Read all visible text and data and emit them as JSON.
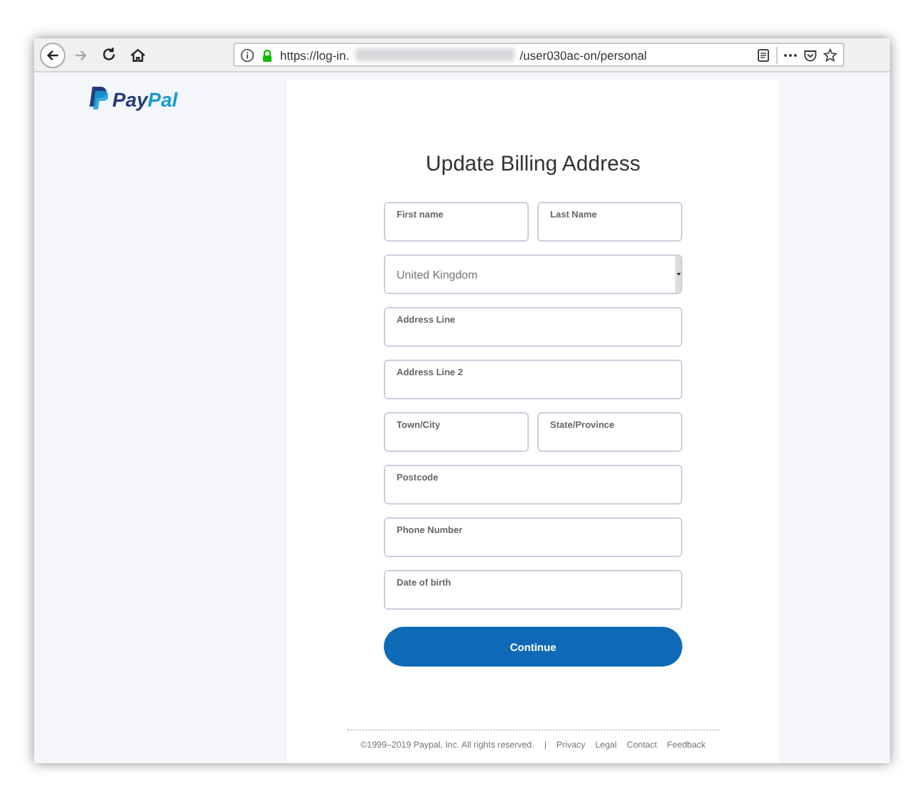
{
  "browser": {
    "nav": [
      {
        "kind": "back",
        "disabled": false
      },
      {
        "kind": "forward",
        "disabled": true
      },
      {
        "kind": "reload",
        "disabled": false
      },
      {
        "kind": "home",
        "disabled": false
      }
    ],
    "url_prefix": "https://log-in.",
    "url_suffix": "/user030ac-on/personal"
  },
  "logo": [
    "Pay",
    "Pal"
  ],
  "title": "Update Billing Address",
  "form_rows": [
    [
      {
        "kind": "text",
        "label": "First name"
      },
      {
        "kind": "text",
        "label": "Last Name"
      }
    ],
    [
      {
        "kind": "select",
        "value": "United Kingdom"
      }
    ],
    [
      {
        "kind": "text",
        "label": "Address Line"
      }
    ],
    [
      {
        "kind": "text",
        "label": "Address Line 2"
      }
    ],
    [
      {
        "kind": "text",
        "label": "Town/City"
      },
      {
        "kind": "text",
        "label": "State/Province"
      }
    ],
    [
      {
        "kind": "text",
        "label": "Postcode"
      }
    ],
    [
      {
        "kind": "text",
        "label": "Phone Number"
      }
    ],
    [
      {
        "kind": "text",
        "label": "Date of birth"
      }
    ]
  ],
  "button": "Continue",
  "footer": {
    "copyright": "©1999–2019 Paypal, Inc. All rights reserved.",
    "separator": "|",
    "links": [
      "Privacy",
      "Legal",
      "Contact",
      "Feedback"
    ]
  }
}
